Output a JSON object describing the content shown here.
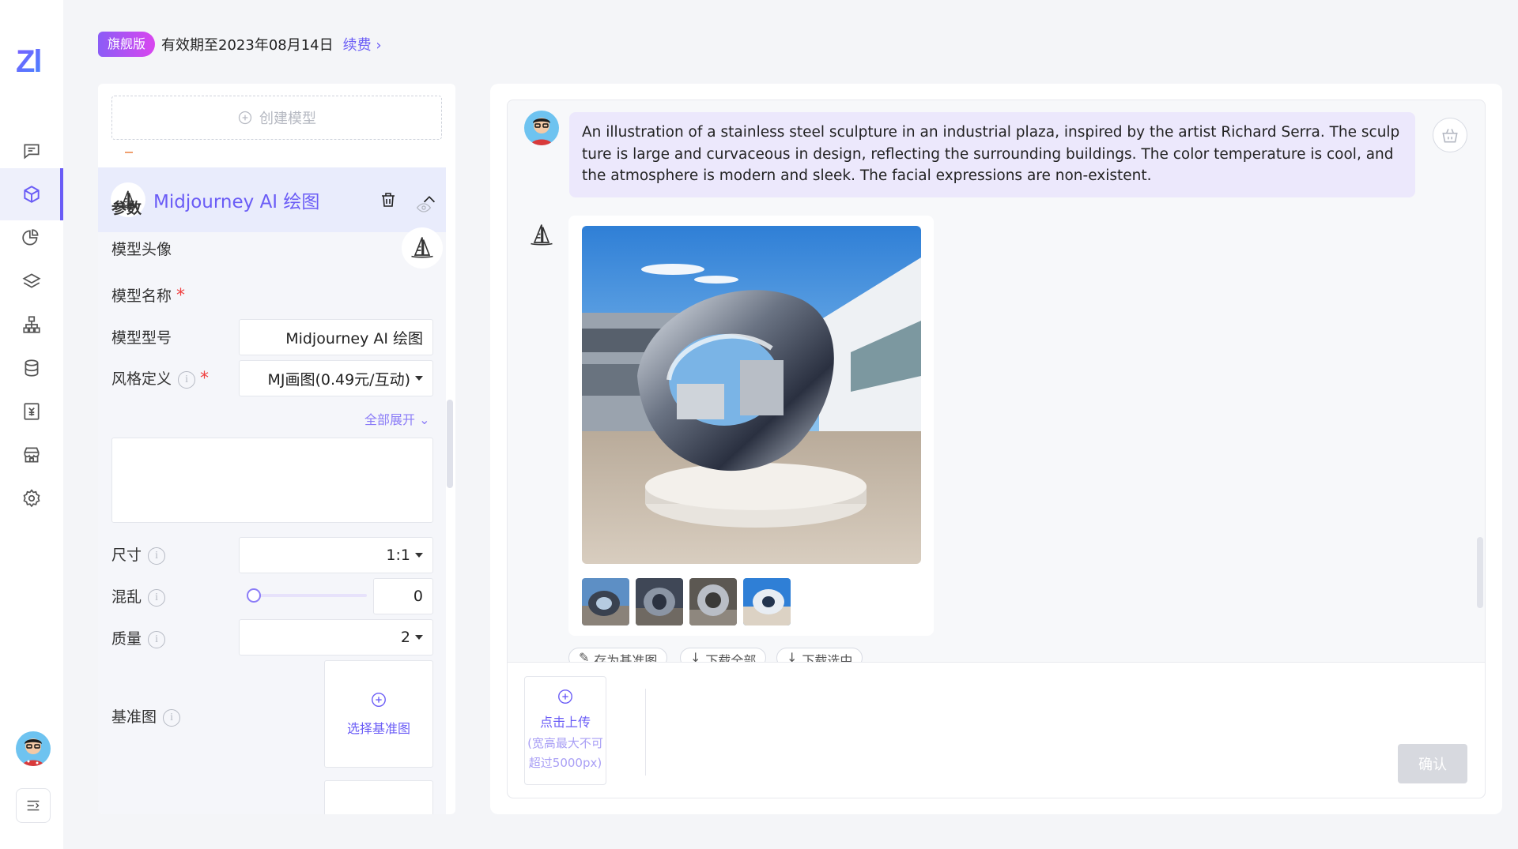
{
  "app": {
    "logo_text": "Zl"
  },
  "rail": {
    "items": [
      {
        "icon": "chat-icon"
      },
      {
        "icon": "cube-icon",
        "active": true
      },
      {
        "icon": "plugin-icon"
      },
      {
        "icon": "layers-icon"
      },
      {
        "icon": "org-chart-icon"
      },
      {
        "icon": "database-icon"
      },
      {
        "icon": "billing-icon"
      },
      {
        "icon": "store-icon"
      },
      {
        "icon": "settings-icon"
      }
    ]
  },
  "header": {
    "badge": "旗舰版",
    "expire_text": "有效期至2023年08月14日",
    "renew_label": "续费"
  },
  "panel": {
    "create_label": "创建模型",
    "model_title": "Midjourney AI 绘图",
    "section_title": "参数",
    "fields": {
      "avatar_label": "模型头像",
      "name_label": "模型名称",
      "name_value": "Midjourney AI 绘图",
      "type_label": "模型型号",
      "type_value": "MJ画图(0.49元/互动)",
      "style_label": "风格定义",
      "expand_all": "全部展开",
      "size_label": "尺寸",
      "size_value": "1:1",
      "chaos_label": "混乱",
      "chaos_value": "0",
      "quality_label": "质量",
      "quality_value": "2",
      "base_label": "基准图",
      "base_upload": "选择基准图"
    }
  },
  "chat": {
    "user_prompt": "An illustration of a stainless steel sculpture in an industrial plaza, inspired by the artist Richard Serra. The sculpture is large and curvaceous in design, reflecting the surrounding buildings. The color temperature is cool, and the atmosphere is modern and sleek. The facial expressions are non-existent.",
    "actions": [
      "存为基准图",
      "下载全部",
      "下载选中"
    ]
  },
  "input": {
    "upload_title": "点击上传",
    "upload_hint": "(宽高最大不可超过5000px)",
    "confirm_label": "确认"
  },
  "colors": {
    "accent": "#6a5cf6",
    "bubble": "#ece8fc",
    "panel_head": "#e9ecfc"
  }
}
